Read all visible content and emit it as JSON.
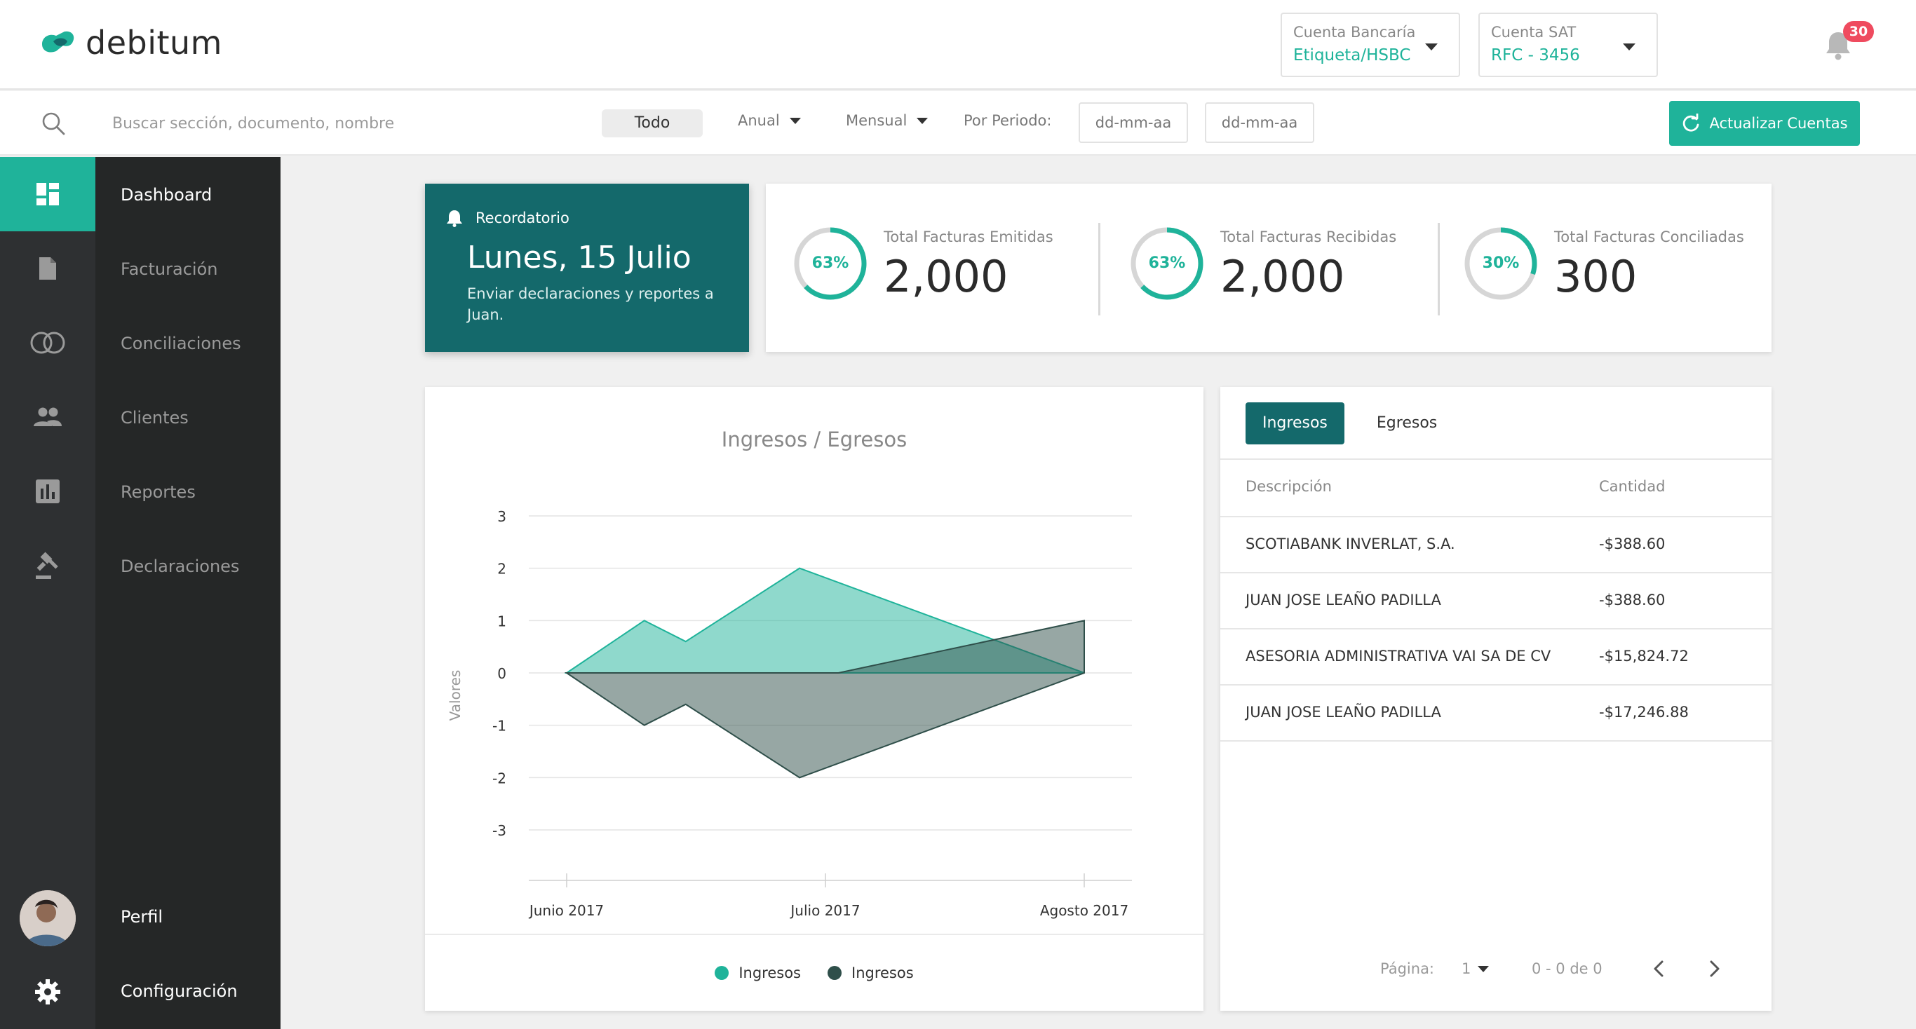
{
  "brand": {
    "name": "debitum"
  },
  "header": {
    "bank_account": {
      "label": "Cuenta Bancaría",
      "value": "Etiqueta/HSBC"
    },
    "sat_account": {
      "label": "Cuenta SAT",
      "value": "RFC - 3456"
    },
    "notifications_count": "30"
  },
  "filters": {
    "search_placeholder": "Buscar sección, documento, nombre",
    "todo": "Todo",
    "anual": "Anual",
    "mensual": "Mensual",
    "periodo_label": "Por Periodo:",
    "date_from_placeholder": "dd-mm-aa",
    "date_to_placeholder": "dd-mm-aa",
    "refresh_button": "Actualizar Cuentas"
  },
  "sidebar": {
    "items": [
      {
        "label": "Dashboard",
        "icon": "dashboard-icon",
        "active": true
      },
      {
        "label": "Facturación",
        "icon": "document-icon"
      },
      {
        "label": "Conciliaciones",
        "icon": "rings-icon"
      },
      {
        "label": "Clientes",
        "icon": "people-icon"
      },
      {
        "label": "Reportes",
        "icon": "bar-chart-icon"
      },
      {
        "label": "Declaraciones",
        "icon": "gavel-icon"
      }
    ],
    "profile": "Perfil",
    "settings": "Configuración"
  },
  "reminder": {
    "title": "Recordatorio",
    "date": "Lunes, 15 Julio",
    "description": "Enviar declaraciones y reportes a Juan."
  },
  "stats": [
    {
      "label": "Total Facturas Emitidas",
      "value": "2,000",
      "percent_label": "63%",
      "percent": 63
    },
    {
      "label": "Total Facturas Recibidas",
      "value": "2,000",
      "percent_label": "63%",
      "percent": 63
    },
    {
      "label": "Total Facturas Conciliadas",
      "value": "300",
      "percent_label": "30%",
      "percent": 30
    }
  ],
  "chart_data": {
    "type": "area",
    "title": "Ingresos / Egresos",
    "ylabel": "Valores",
    "xlabel": "",
    "ylim": [
      -3,
      3
    ],
    "yticks": [
      3,
      2,
      1,
      0,
      -1,
      -2,
      -3
    ],
    "xtick_labels": [
      "Junio 2017",
      "Julio 2017",
      "Agosto 2017"
    ],
    "x_range": [
      0,
      2
    ],
    "grid": true,
    "legend": "bottom",
    "colors": {
      "ingresos": "#1fb39a",
      "egresos": "#2f4f4a"
    },
    "series": [
      {
        "name": "Ingresos",
        "points": [
          [
            0,
            0
          ],
          [
            0.3,
            1
          ],
          [
            0.46,
            0.6
          ],
          [
            0.9,
            2
          ],
          [
            2,
            0
          ]
        ]
      },
      {
        "name": "Ingresos",
        "points": [
          [
            0,
            0
          ],
          [
            0.3,
            -1
          ],
          [
            0.46,
            -0.6
          ],
          [
            0.9,
            -2
          ],
          [
            2,
            0
          ],
          [
            2,
            1
          ],
          [
            1.05,
            0
          ],
          [
            0.0,
            0
          ]
        ]
      }
    ]
  },
  "table": {
    "tabs": [
      "Ingresos",
      "Egresos"
    ],
    "active_tab": 0,
    "columns": [
      "Descripción",
      "Cantidad"
    ],
    "rows": [
      {
        "descripcion": "SCOTIABANK INVERLAT, S.A.",
        "cantidad": "-$388.60"
      },
      {
        "descripcion": "JUAN JOSE LEAÑO PADILLA",
        "cantidad": "-$388.60"
      },
      {
        "descripcion": "ASESORIA ADMINISTRATIVA VAI SA DE CV",
        "cantidad": "-$15,824.72"
      },
      {
        "descripcion": "JUAN JOSE LEAÑO PADILLA",
        "cantidad": "-$17,246.88"
      }
    ],
    "pagination": {
      "label": "Página:",
      "page": "1",
      "range": "0 - 0 de 0"
    }
  },
  "colors": {
    "accent": "#1fb39a",
    "dark_teal": "#14696b",
    "sidebar": "#252727",
    "badge": "#ef4b5f"
  }
}
